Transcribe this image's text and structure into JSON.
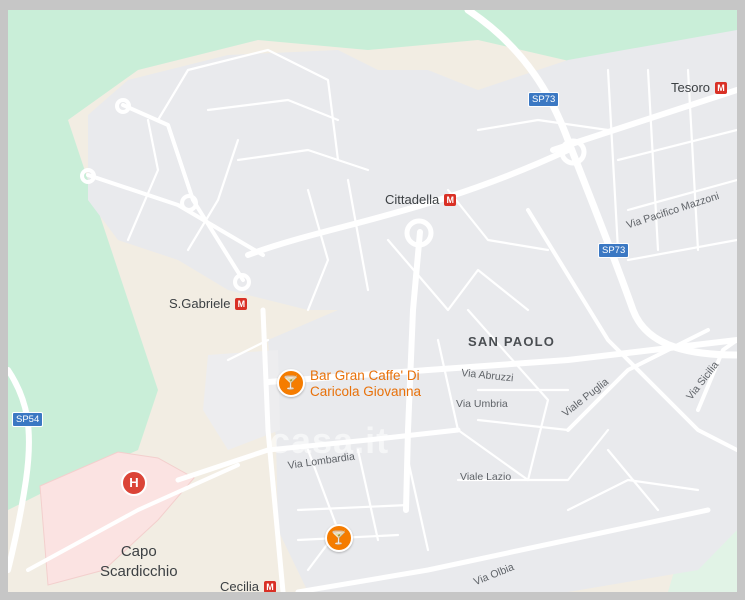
{
  "map": {
    "places": [
      {
        "id": "cittadella",
        "label": "Cittadella",
        "metro": true
      },
      {
        "id": "tesoro",
        "label": "Tesoro",
        "metro": true
      },
      {
        "id": "s-gabriele",
        "label": "S.Gabriele",
        "metro": true
      },
      {
        "id": "cecilia",
        "label": "Cecilia",
        "metro": true
      }
    ],
    "district": "SAN PAOLO",
    "city": [
      "Capo",
      "Scardicchio"
    ],
    "streets": [
      "Via Pacifico Mazzoni",
      "Via Abruzzi",
      "Via Umbria",
      "Viale Puglia",
      "Via Sicilia",
      "Via Lombardia",
      "Viale Lazio",
      "Via Olbia"
    ],
    "road_shields": [
      "SP73",
      "SP73",
      "SP54"
    ],
    "poi": {
      "name": "Bar Gran Caffe' Di Caricola Giovanna",
      "line1": "Bar Gran Caffe' Di",
      "line2": "Caricola Giovanna",
      "icon": "cocktail-icon"
    },
    "second_poi_icon": "cocktail-icon",
    "hospital_icon": "hospital-icon",
    "metro_icon": "metro-icon",
    "watermark": "casa.it",
    "colors": {
      "land": "#f2ede3",
      "park": "#c9eed8",
      "residential": "#e9eaed",
      "road": "#ffffff",
      "hospital_area": "#fbe3e2",
      "poi": "#e8710a",
      "shield": "#3b78c3",
      "metro": "#d93025"
    }
  }
}
